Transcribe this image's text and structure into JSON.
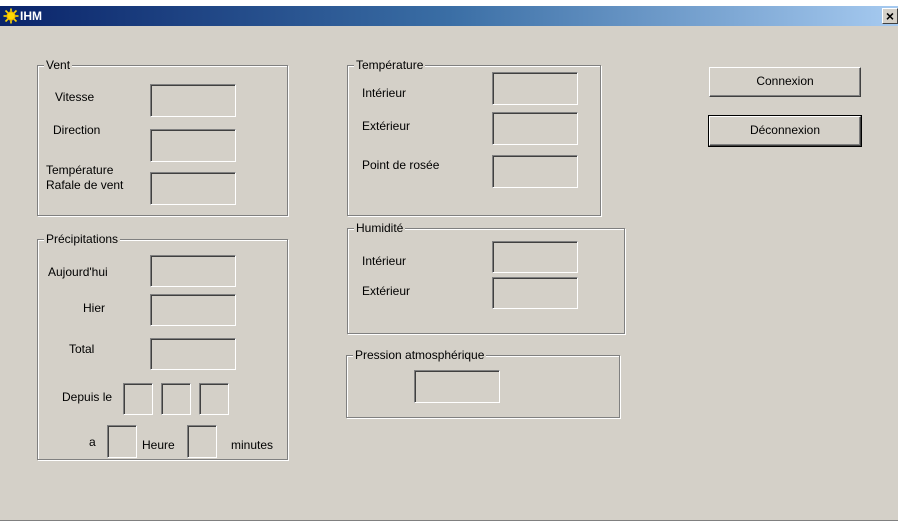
{
  "window": {
    "title": "IHM",
    "close_glyph": "×",
    "title_icon": "sun-icon"
  },
  "vent": {
    "legend": "Vent",
    "vitesse": "Vitesse",
    "direction": "Direction",
    "temperature": "Température",
    "rafale": "Rafale de vent"
  },
  "precipitations": {
    "legend": "Précipitations",
    "aujourdhui": "Aujourd'hui",
    "hier": "Hier",
    "total": "Total",
    "depuis": "Depuis le",
    "a": "a",
    "heure": "Heure",
    "minutes": "minutes"
  },
  "temperature": {
    "legend": "Température",
    "interieur": "Intérieur",
    "exterieur": "Extérieur",
    "rosee": "Point de rosée"
  },
  "humidite": {
    "legend": "Humidité",
    "interieur": "Intérieur",
    "exterieur": "Extérieur"
  },
  "pression": {
    "legend": "Pression atmosphérique"
  },
  "buttons": {
    "connexion": "Connexion",
    "deconnexion": "Déconnexion"
  },
  "colors": {
    "face": "#d4d0c8",
    "title_dark": "#0a246a",
    "title_light": "#a6caf0"
  }
}
